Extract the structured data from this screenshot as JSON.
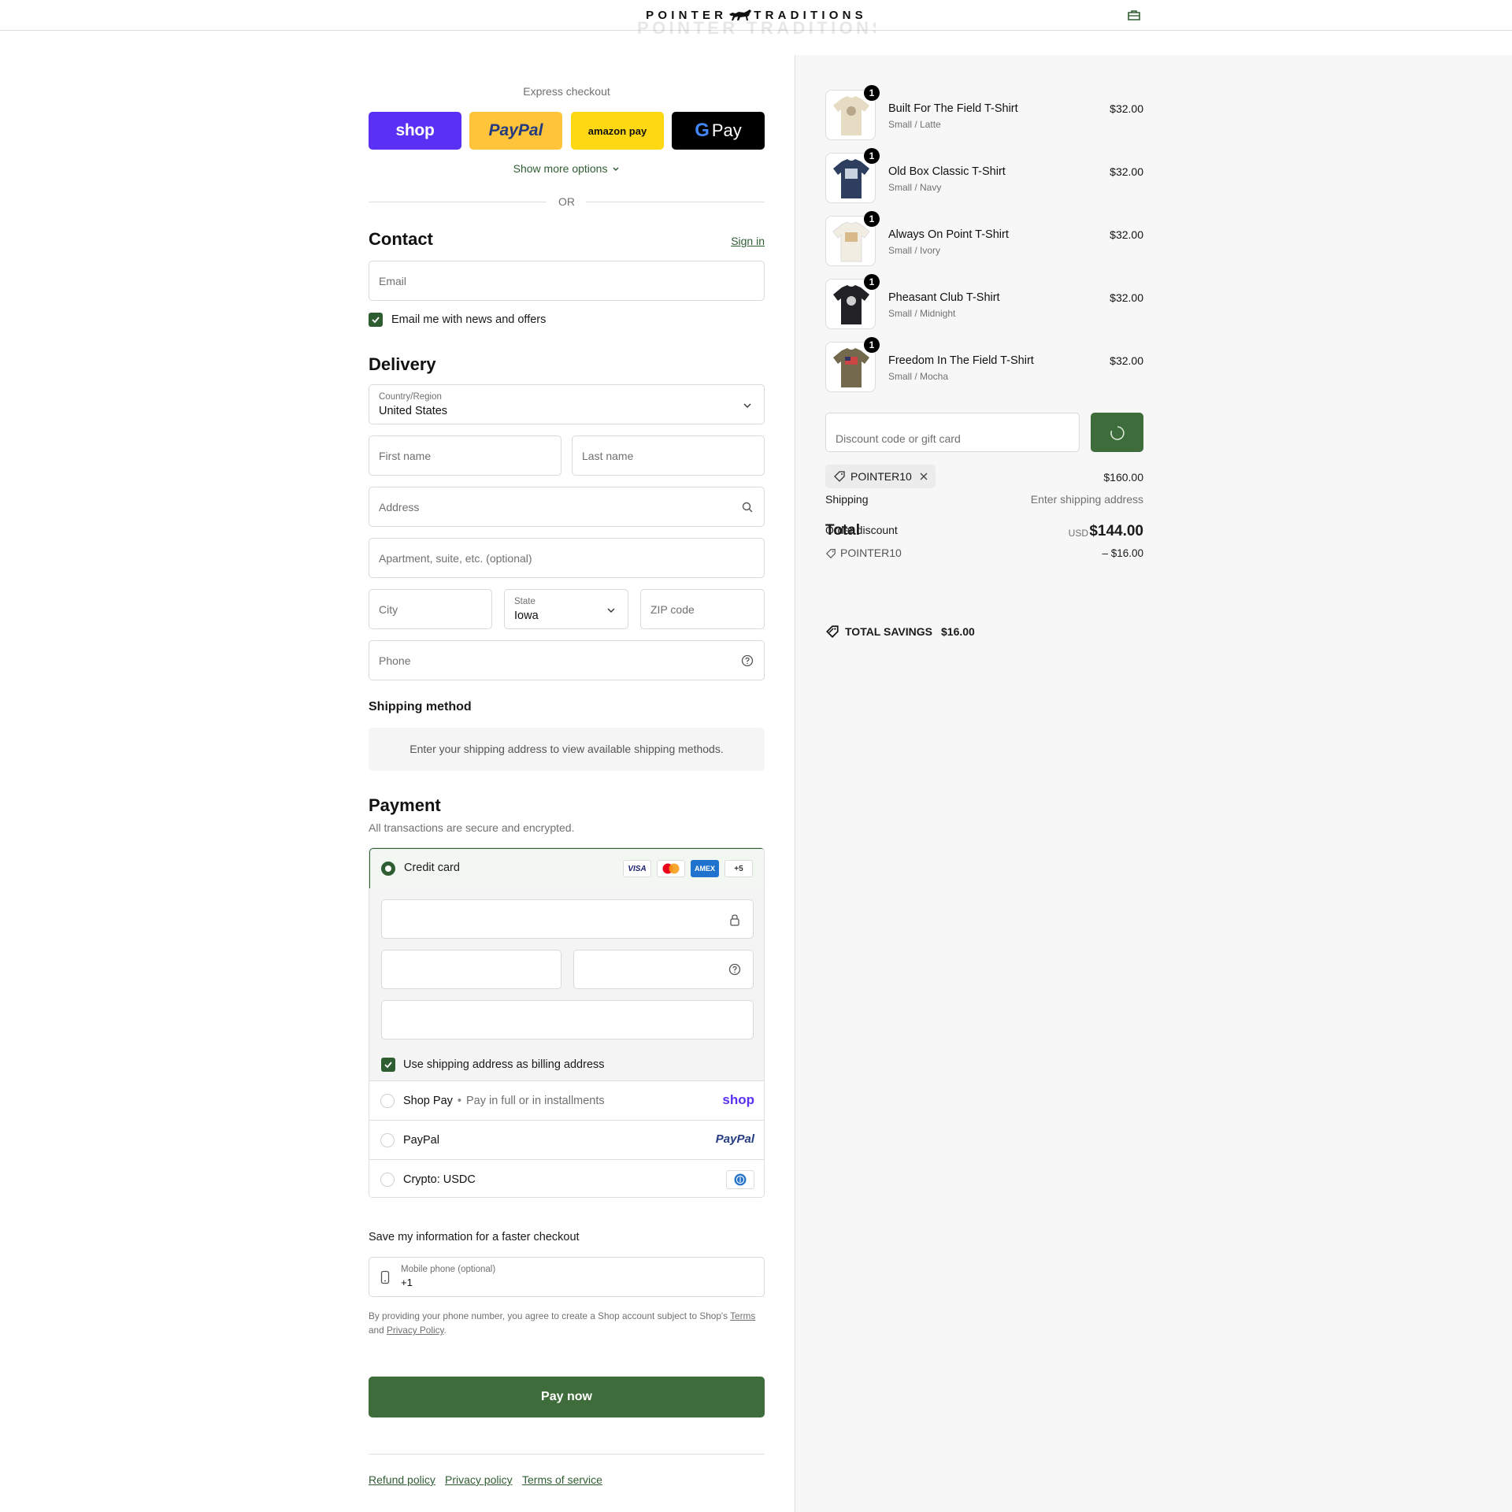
{
  "header": {
    "logo_left": "POINTER",
    "logo_right": "TRADITIONS",
    "logo_ghost": "POINTER TRADITIONS"
  },
  "express": {
    "title": "Express checkout",
    "buttons": [
      "shop",
      "PayPal",
      "amazon pay",
      "Pay"
    ],
    "more": "Show more options",
    "or": "OR"
  },
  "contact": {
    "title": "Contact",
    "sign_in": "Sign in",
    "email_placeholder": "Email",
    "newsletter": "Email me with news and offers"
  },
  "delivery": {
    "title": "Delivery",
    "country_label": "Country/Region",
    "country_value": "United States",
    "first_name": "First name",
    "last_name": "Last name",
    "address": "Address",
    "apartment": "Apartment, suite, etc. (optional)",
    "city": "City",
    "state_label": "State",
    "state_value": "Iowa",
    "zip": "ZIP code",
    "phone": "Phone"
  },
  "shipping_method": {
    "title": "Shipping method",
    "info": "Enter your shipping address to view available shipping methods."
  },
  "payment": {
    "title": "Payment",
    "subtitle": "All transactions are secure and encrypted.",
    "credit_card": "Credit card",
    "card_brands": [
      "VISA",
      "Mastercard",
      "AMEX",
      "+5"
    ],
    "billing_same": "Use shipping address as billing address",
    "shop_pay": "Shop Pay",
    "shop_pay_note": "Pay in full or in installments",
    "shop_logo": "shop",
    "paypal": "PayPal",
    "paypal_logo": "PayPal",
    "crypto": "Crypto: USDC"
  },
  "save": {
    "title": "Save my information for a faster checkout",
    "mobile_label": "Mobile phone (optional)",
    "mobile_value": "+1",
    "legal_prefix": "By providing your phone number, you agree to create a Shop account subject to Shop's",
    "terms": "Terms",
    "and": "and",
    "privacy": "Privacy Policy",
    "period": "."
  },
  "pay_now": "Pay now",
  "footer": {
    "refund": "Refund policy",
    "privacy": "Privacy policy",
    "terms": "Terms of service"
  },
  "cart": {
    "items": [
      {
        "name": "Built For The Field T-Shirt",
        "variant": "Small / Latte",
        "price": "$32.00",
        "qty": "1",
        "color": "#e6dcc4"
      },
      {
        "name": "Old Box Classic T-Shirt",
        "variant": "Small / Navy",
        "price": "$32.00",
        "qty": "1",
        "color": "#2d3e5e"
      },
      {
        "name": "Always On Point T-Shirt",
        "variant": "Small / Ivory",
        "price": "$32.00",
        "qty": "1",
        "color": "#f1ede2"
      },
      {
        "name": "Pheasant Club T-Shirt",
        "variant": "Small / Midnight",
        "price": "$32.00",
        "qty": "1",
        "color": "#222226"
      },
      {
        "name": "Freedom In The Field T-Shirt",
        "variant": "Small / Mocha",
        "price": "$32.00",
        "qty": "1",
        "color": "#74694c"
      }
    ],
    "discount_placeholder": "Discount code or gift card",
    "applied_code": "POINTER10",
    "subtotal": "$160.00",
    "shipping_label": "Shipping",
    "shipping_value": "Enter shipping address",
    "total_label": "Total",
    "order_discount_label": "Order discount",
    "currency": "USD",
    "total": "$144.00",
    "discount_code": "POINTER10",
    "discount_amount": "– $16.00",
    "savings_label": "TOTAL SAVINGS",
    "savings_value": "$16.00"
  },
  "colors": {
    "accent": "#2f5d32",
    "shop_purple": "#5a31f4",
    "paypal_yellow": "#ffc439",
    "amazon_yellow": "#ffd814"
  }
}
